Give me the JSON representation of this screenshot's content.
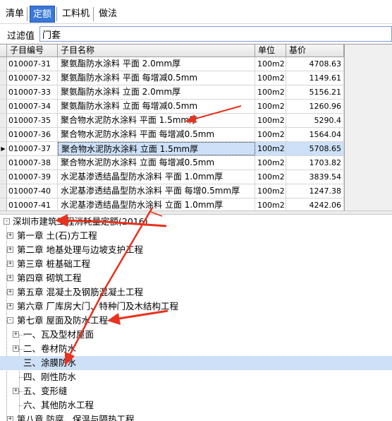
{
  "tabs": [
    {
      "label": "清单",
      "active": false
    },
    {
      "label": "定额",
      "active": true
    },
    {
      "label": "工料机",
      "active": false
    },
    {
      "label": "做法",
      "active": false
    }
  ],
  "filter": {
    "label": "过滤值",
    "value": "门套"
  },
  "grid": {
    "columns": [
      "子目编号",
      "子目名称",
      "单位",
      "基价"
    ],
    "rows": [
      {
        "code": "010007-31",
        "name": "聚氨酯防水涂料 平面 2.0mm厚",
        "unit": "100m2",
        "price": "4708.63"
      },
      {
        "code": "010007-32",
        "name": "聚氨酯防水涂料 平面 每增减0.5mm",
        "unit": "100m2",
        "price": "1149.61"
      },
      {
        "code": "010007-33",
        "name": "聚氨酯防水涂料 立面 2.0mm厚",
        "unit": "100m2",
        "price": "5156.21"
      },
      {
        "code": "010007-34",
        "name": "聚氨酯防水涂料 立面 每增减0.5mm",
        "unit": "100m2",
        "price": "1260.96"
      },
      {
        "code": "010007-35",
        "name": "聚合物水泥防水涂料 平面 1.5mm厚",
        "unit": "100m2",
        "price": "5290.4"
      },
      {
        "code": "010007-36",
        "name": "聚合物水泥防水涂料 平面 每增减0.5mm",
        "unit": "100m2",
        "price": "1564.04"
      },
      {
        "code": "010007-37",
        "name": "聚合物水泥防水涂料 立面 1.5mm厚",
        "unit": "100m2",
        "price": "5708.65",
        "selected": true
      },
      {
        "code": "010007-38",
        "name": "聚合物水泥防水涂料 立面 每增减0.5mm",
        "unit": "100m2",
        "price": "1703.82"
      },
      {
        "code": "010007-39",
        "name": "水泥基渗透结晶型防水涂料 平面 1.0mm厚",
        "unit": "100m2",
        "price": "3839.54"
      },
      {
        "code": "010007-40",
        "name": "水泥基渗透结晶型防水涂料 平面 每增0.5mm厚",
        "unit": "100m2",
        "price": "1247.38"
      },
      {
        "code": "010007-41",
        "name": "水泥基渗透结晶型防水涂料 立面 1.0mm厚",
        "unit": "100m2",
        "price": "4242.06"
      }
    ]
  },
  "tree": {
    "root": "深圳市建筑工程消耗量定额(2016)",
    "chapters": [
      "第一章 土(石)方工程",
      "第二章 地基处理与边坡支护工程",
      "第三章 桩基础工程",
      "第四章 砌筑工程",
      "第五章 混凝土及钢筋混凝土工程",
      "第六章 厂库房大门、特种门及木结构工程",
      "第七章 屋面及防水工程"
    ],
    "sections": [
      "一、瓦及型材屋面",
      "二、卷材防水",
      "三、涂膜防水",
      "四、刚性防水",
      "五、变形缝",
      "六、其他防水工程"
    ],
    "next_chapter": "第八章 防腐、保温与隔热工程"
  },
  "colors": {
    "tab_active": "#3a78d8",
    "selection": "#cde0f7",
    "arrow": "#e8321e"
  }
}
